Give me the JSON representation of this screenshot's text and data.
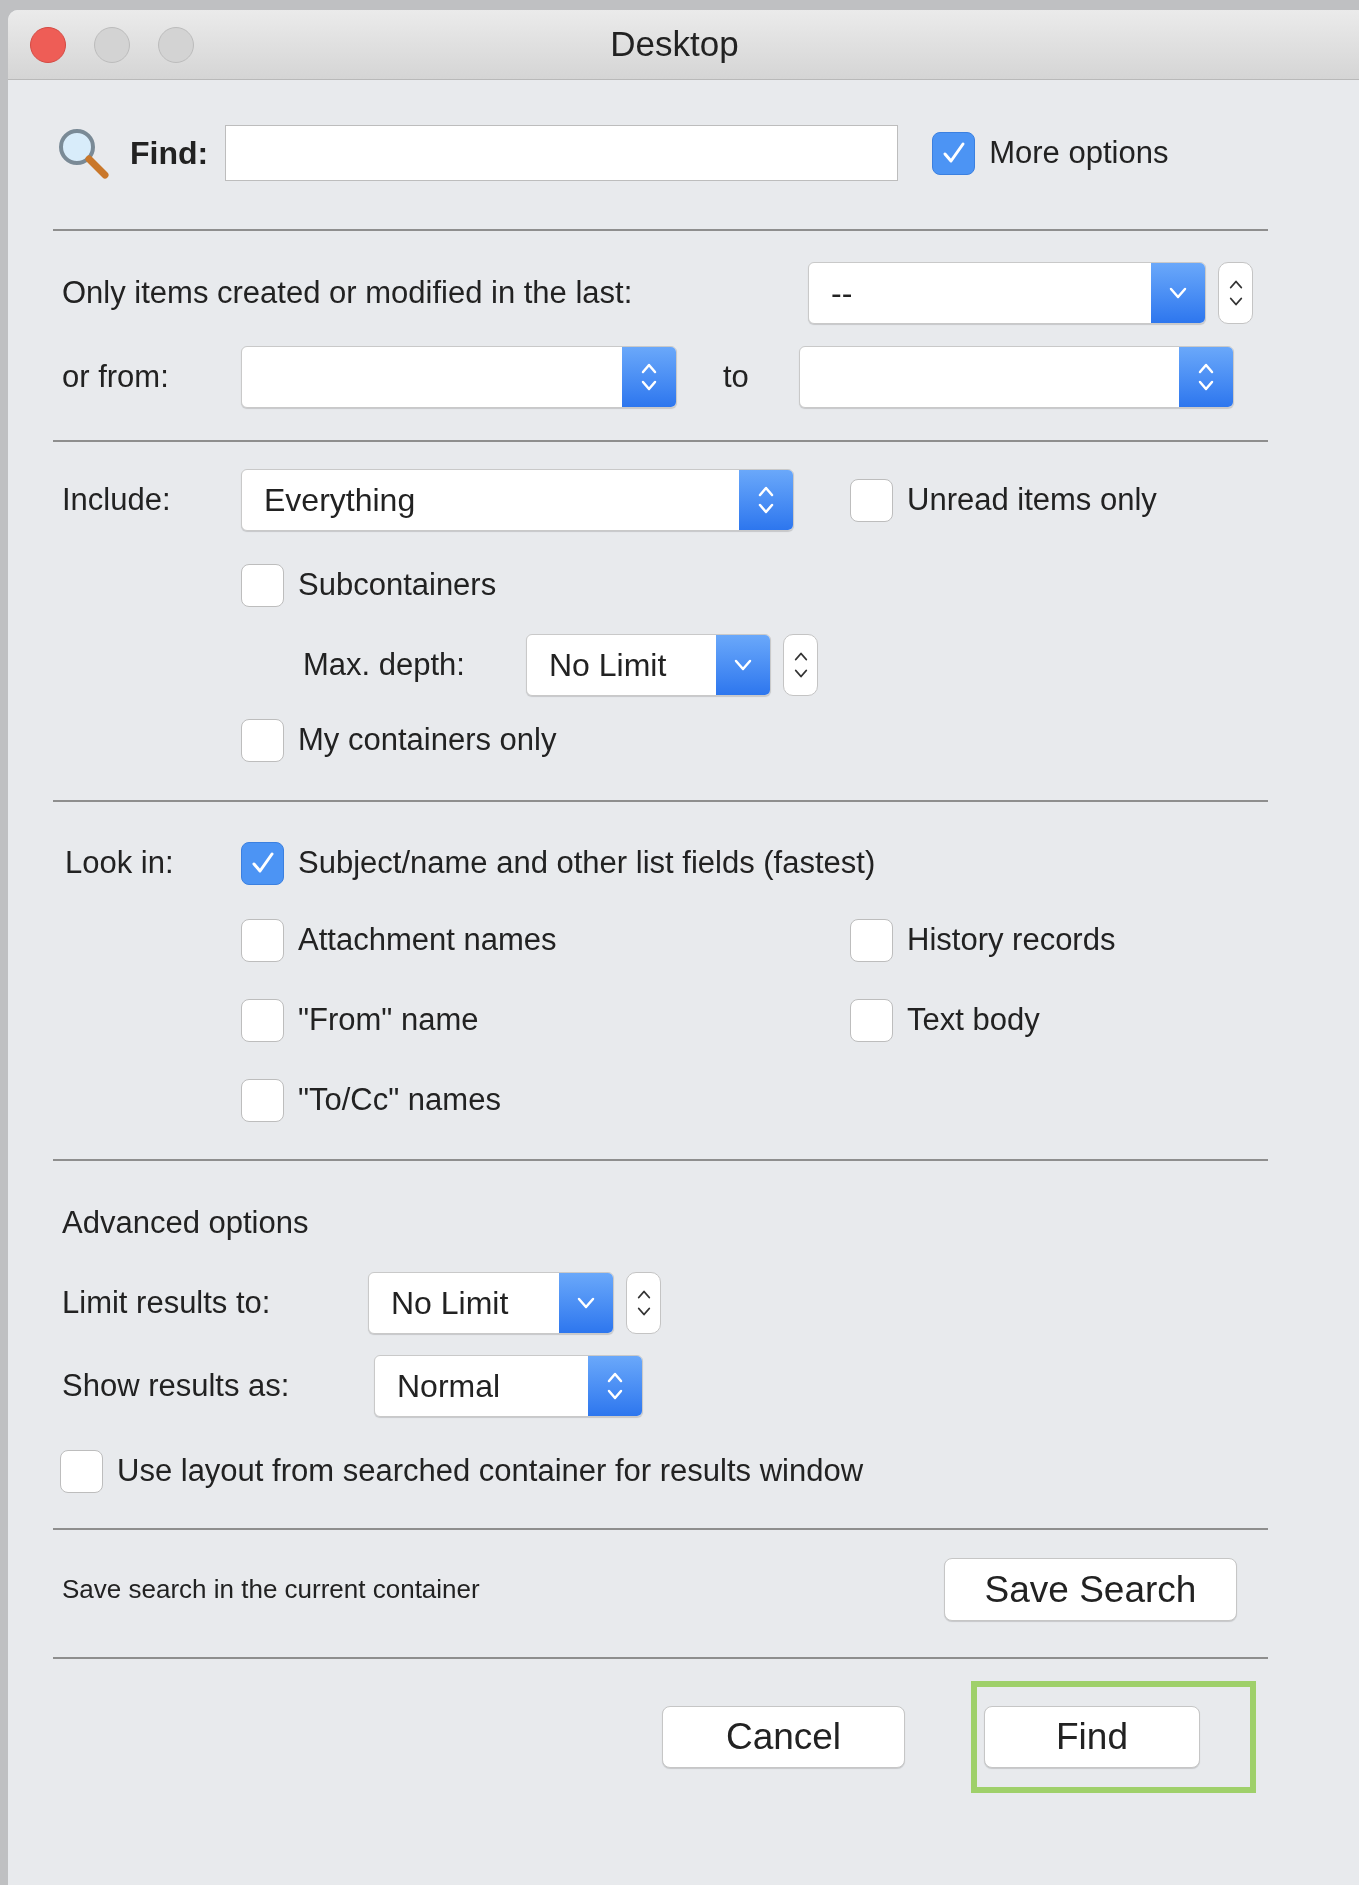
{
  "window": {
    "title": "Desktop"
  },
  "find": {
    "label": "Find:"
  },
  "more_options": {
    "label": "More options",
    "checked": true
  },
  "date_filter": {
    "label": "Only items created or modified in the last:",
    "period": {
      "kind": "popup",
      "value": "--"
    },
    "from_label": "or from:",
    "from": {
      "kind": "updown"
    },
    "to_label": "to",
    "to": {
      "kind": "updown"
    }
  },
  "include": {
    "label": "Include:",
    "scope": {
      "kind": "updown",
      "value": "Everything"
    },
    "unread_only": {
      "label": "Unread items only",
      "checked": false
    },
    "subcontainers": {
      "label": "Subcontainers",
      "checked": false
    },
    "max_depth": {
      "label": "Max. depth:",
      "select": {
        "kind": "popup",
        "value": "No Limit"
      }
    },
    "my_containers_only": {
      "label": "My containers only",
      "checked": false
    }
  },
  "look_in": {
    "label": "Look in:",
    "options": [
      {
        "label": "Subject/name and other list fields (fastest)",
        "checked": true
      },
      {
        "label": "Attachment names",
        "checked": false
      },
      {
        "label": "History records",
        "checked": false
      },
      {
        "label": "\"From\" name",
        "checked": false
      },
      {
        "label": "Text body",
        "checked": false
      },
      {
        "label": "\"To/Cc\" names",
        "checked": false
      }
    ]
  },
  "advanced": {
    "heading": "Advanced options",
    "limit": {
      "label": "Limit results to:",
      "select": {
        "kind": "popup",
        "value": "No Limit"
      }
    },
    "show_as": {
      "label": "Show results as:",
      "select": {
        "kind": "updown",
        "value": "Normal"
      }
    },
    "use_layout": {
      "label": "Use layout from searched container for results window",
      "checked": false
    }
  },
  "save": {
    "text": "Save search in the current container",
    "button": "Save Search"
  },
  "buttons": [
    {
      "label": "Cancel",
      "highlighted": false
    },
    {
      "label": "Find",
      "highlighted": true
    }
  ]
}
